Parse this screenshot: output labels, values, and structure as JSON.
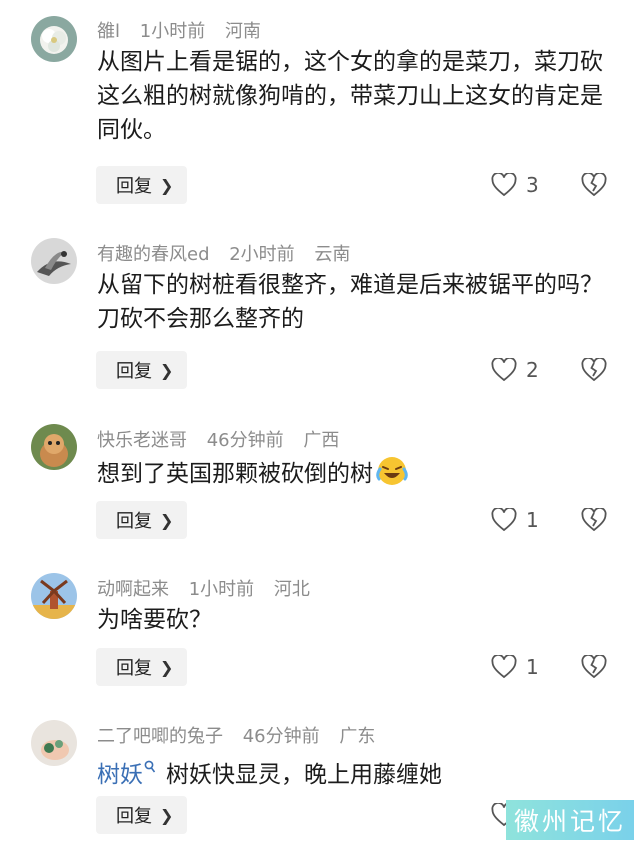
{
  "comments": [
    {
      "username": "雒l",
      "time": "1小时前",
      "location": "河南",
      "text": "从图片上看是锯的，这个女的拿的是菜刀，菜刀砍这么粗的树就像狗啃的，带菜刀山上这女的肯定是同伙。",
      "reply_label": "回复",
      "likes": "3"
    },
    {
      "username": "有趣的春风ed",
      "time": "2小时前",
      "location": "云南",
      "text": "从留下的树桩看很整齐，难道是后来被锯平的吗？刀砍不会那么整齐的",
      "reply_label": "回复",
      "likes": "2"
    },
    {
      "username": "快乐老迷哥",
      "time": "46分钟前",
      "location": "广西",
      "text": "想到了英国那颗被砍倒的树",
      "emoji": "laughing-crying-emoji",
      "reply_label": "回复",
      "likes": "1"
    },
    {
      "username": "动啊起来",
      "time": "1小时前",
      "location": "河北",
      "text": "为啥要砍？",
      "reply_label": "回复",
      "likes": "1"
    },
    {
      "username": "二了吧唧的兔子",
      "time": "46分钟前",
      "location": "广东",
      "mention": "树妖",
      "text": "树妖快显灵，晚上用藤缠她",
      "reply_label": "回复",
      "likes": ""
    }
  ],
  "watermark": "徽州记忆",
  "colors": {
    "meta_text": "#8c8c8c",
    "mention": "#3a6fb5",
    "reply_bg": "#f2f2f2"
  }
}
